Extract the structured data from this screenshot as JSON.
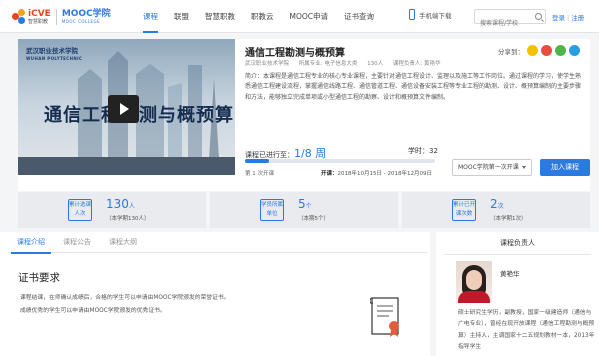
{
  "logo": {
    "brand_cn": "智慧职教",
    "brand_en": "iCVE",
    "mooc": "MOOC学院",
    "mooc_en": "MOOC COLLEGE"
  },
  "nav": [
    "课程",
    "联盟",
    "智慧职教",
    "职教云",
    "MOOC申请",
    "证书查询"
  ],
  "header": {
    "mobile_label": "手机端下载",
    "search_placeholder": "搜索课程/学校",
    "login": "登录",
    "divider": "|",
    "register": "注册"
  },
  "course": {
    "thumb_school": "武汉职业技术学院",
    "thumb_school_en": "WUHAN POLYTECHNIC",
    "thumb_title": "通信工程勘测与概预算",
    "title": "通信工程勘测与概预算",
    "share_label": "分享到：",
    "meta": [
      "武汉职业技术学院",
      "所属专业: 电子信息大类",
      "130人",
      "课程负责人: 黄艳华"
    ],
    "intro": "简介：本课程是通信工程专业的核心专业课程，主要针对通信工程设计、监理以及施工等工作岗位。通过课程的学习，使学生熟悉通信工程建设流程，掌握通信线路工程、通信管道工程、通信设备安装工程等专业工程的勘测、设计、概预算编制的主要步骤和方法，能够独立完成单项或小型通信工程的勘察、设计和概预算文件编制。",
    "progress_label": "课程已进行至：",
    "progress_value": "1/8 周",
    "progress_fraction": 0.125,
    "hours_label": "学时：",
    "hours_value": "32",
    "session": "第 1 次开课",
    "dates_label": "开课：",
    "dates_value": "2018年10月15日 - 2018年12月09日",
    "term_select": "MOOC学院第一次开课",
    "join_button": "加入课程"
  },
  "stats": [
    {
      "label": "累计选课人次",
      "num": "130",
      "unit": "人",
      "sub": "（本学期130人）"
    },
    {
      "label": "学员所属单位",
      "num": "5",
      "unit": "个",
      "sub": "（本期5个）"
    },
    {
      "label": "累计已开课次数",
      "num": "2",
      "unit": "次",
      "sub": "（本学期1次）"
    }
  ],
  "tabs": [
    "课程介绍",
    "课程公告",
    "课程大纲"
  ],
  "certificate": {
    "heading": "证书要求",
    "line1": "课程结课，在师确认成绩后，合格的学生可以申请由MOOC学院颁发的荣誉证书。",
    "line2": "成绩优秀的学生可以申请由MOOC学院颁发的优秀证书。"
  },
  "teacher": {
    "heading": "课程负责人",
    "name": "黄艳华",
    "bio": "硕士研究生学历，副教授，国家一级建造师（通信与广电专业），曾经在现开放课程（通信工程勘测与概预算）主持人，主调国家十二五规划教材一本，2013年指导学生"
  },
  "colors": {
    "accent": "#2a7ae2",
    "logo_red": "#e9461f"
  }
}
